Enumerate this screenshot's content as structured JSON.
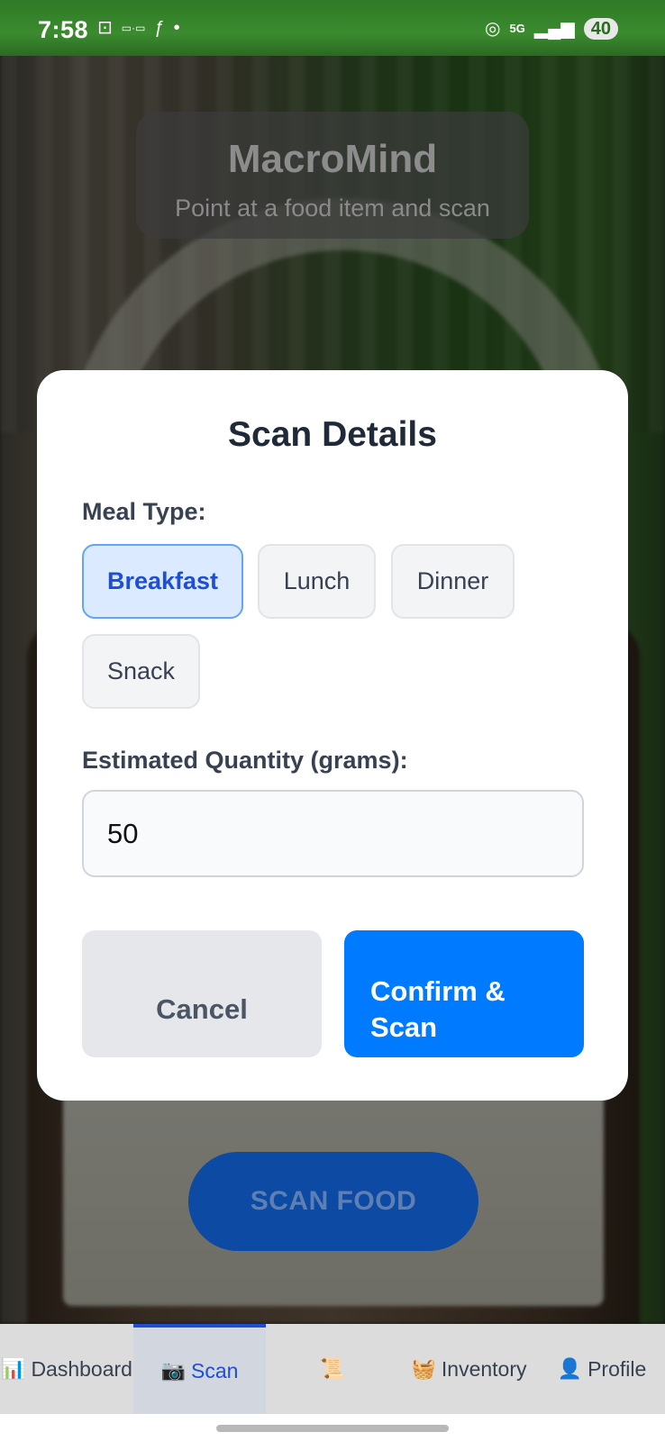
{
  "status_bar": {
    "time": "7:58",
    "network": "5G",
    "battery": "40"
  },
  "header": {
    "title": "MacroMind",
    "subtitle": "Point at a food item and scan"
  },
  "scan_button": {
    "label": "SCAN FOOD"
  },
  "modal": {
    "title": "Scan Details",
    "meal_type_label": "Meal Type:",
    "meal_options": [
      {
        "label": "Breakfast",
        "selected": true
      },
      {
        "label": "Lunch",
        "selected": false
      },
      {
        "label": "Dinner",
        "selected": false
      },
      {
        "label": "Snack",
        "selected": false
      }
    ],
    "quantity_label": "Estimated Quantity (grams):",
    "quantity_value": "50",
    "cancel_label": "Cancel",
    "confirm_label_line1": "Confirm &",
    "confirm_label_line2": "Scan"
  },
  "bottom_nav": {
    "items": [
      {
        "icon": "📊",
        "label": "Dashboard",
        "active": false
      },
      {
        "icon": "📷",
        "label": "Scan",
        "active": true
      },
      {
        "icon": "📜",
        "label": "",
        "active": false
      },
      {
        "icon": "🧺",
        "label": "Inventory",
        "active": false
      },
      {
        "icon": "👤",
        "label": "Profile",
        "active": false
      }
    ]
  },
  "colors": {
    "accent": "#007bff",
    "selected_bg": "#dbeafe",
    "selected_text": "#1d4ed8",
    "status_bar": "#2f7a26"
  }
}
